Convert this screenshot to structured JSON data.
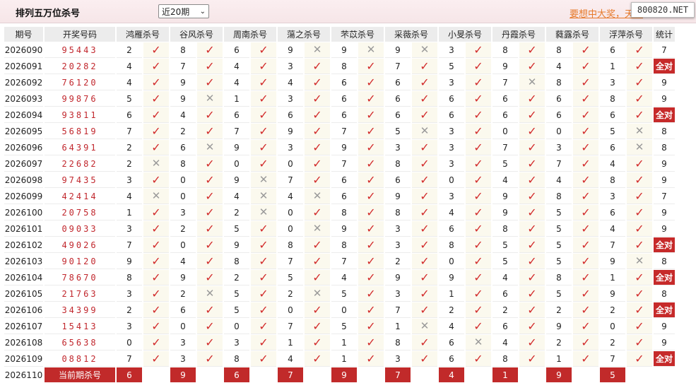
{
  "header": {
    "title": "排列五万位杀号",
    "period_selected": "近20期",
    "promo_text": "要想中大奖，天天",
    "watermark": "800820.NET"
  },
  "columns": {
    "issue": "期号",
    "code": "开奖号码",
    "experts": [
      "鸿雁杀号",
      "谷风杀号",
      "周南杀号",
      "蕩之杀号",
      "芣苡杀号",
      "采薇杀号",
      "小旻杀号",
      "丹霞杀号",
      "蕤露杀号",
      "浮萍杀号"
    ],
    "stat": "统计"
  },
  "rows": [
    {
      "issue": "2026090",
      "code": "95443",
      "kills": [
        2,
        8,
        6,
        9,
        9,
        9,
        3,
        8,
        8,
        6
      ],
      "hits": [
        1,
        1,
        1,
        0,
        0,
        0,
        1,
        1,
        1,
        1
      ],
      "stat": "7",
      "all": false
    },
    {
      "issue": "2026091",
      "code": "20282",
      "kills": [
        4,
        7,
        4,
        3,
        8,
        7,
        5,
        9,
        4,
        1
      ],
      "hits": [
        1,
        1,
        1,
        1,
        1,
        1,
        1,
        1,
        1,
        1
      ],
      "stat": "全对",
      "all": true
    },
    {
      "issue": "2026092",
      "code": "76120",
      "kills": [
        4,
        9,
        4,
        4,
        6,
        6,
        3,
        7,
        8,
        3
      ],
      "hits": [
        1,
        1,
        1,
        1,
        1,
        1,
        1,
        0,
        1,
        1
      ],
      "stat": "9",
      "all": false
    },
    {
      "issue": "2026093",
      "code": "99876",
      "kills": [
        5,
        9,
        1,
        3,
        6,
        6,
        6,
        6,
        6,
        8
      ],
      "hits": [
        1,
        0,
        1,
        1,
        1,
        1,
        1,
        1,
        1,
        1
      ],
      "stat": "9",
      "all": false
    },
    {
      "issue": "2026094",
      "code": "93811",
      "kills": [
        6,
        4,
        6,
        6,
        6,
        6,
        6,
        6,
        6,
        6
      ],
      "hits": [
        1,
        1,
        1,
        1,
        1,
        1,
        1,
        1,
        1,
        1
      ],
      "stat": "全对",
      "all": true
    },
    {
      "issue": "2026095",
      "code": "56819",
      "kills": [
        7,
        2,
        7,
        9,
        7,
        5,
        3,
        0,
        0,
        5
      ],
      "hits": [
        1,
        1,
        1,
        1,
        1,
        0,
        1,
        1,
        1,
        0
      ],
      "stat": "8",
      "all": false
    },
    {
      "issue": "2026096",
      "code": "64391",
      "kills": [
        2,
        6,
        9,
        3,
        9,
        3,
        3,
        7,
        3,
        6
      ],
      "hits": [
        1,
        0,
        1,
        1,
        1,
        1,
        1,
        1,
        1,
        0
      ],
      "stat": "8",
      "all": false
    },
    {
      "issue": "2026097",
      "code": "22682",
      "kills": [
        2,
        8,
        0,
        0,
        7,
        8,
        3,
        5,
        7,
        4
      ],
      "hits": [
        0,
        1,
        1,
        1,
        1,
        1,
        1,
        1,
        1,
        1
      ],
      "stat": "9",
      "all": false
    },
    {
      "issue": "2026098",
      "code": "97435",
      "kills": [
        3,
        0,
        9,
        7,
        6,
        6,
        0,
        4,
        4,
        8
      ],
      "hits": [
        1,
        1,
        0,
        1,
        1,
        1,
        1,
        1,
        1,
        1
      ],
      "stat": "9",
      "all": false
    },
    {
      "issue": "2026099",
      "code": "42414",
      "kills": [
        4,
        0,
        4,
        4,
        6,
        9,
        3,
        9,
        8,
        3
      ],
      "hits": [
        0,
        1,
        0,
        0,
        1,
        1,
        1,
        1,
        1,
        1
      ],
      "stat": "7",
      "all": false
    },
    {
      "issue": "2026100",
      "code": "20758",
      "kills": [
        1,
        3,
        2,
        0,
        8,
        8,
        4,
        9,
        5,
        6
      ],
      "hits": [
        1,
        1,
        0,
        1,
        1,
        1,
        1,
        1,
        1,
        1
      ],
      "stat": "9",
      "all": false
    },
    {
      "issue": "2026101",
      "code": "09033",
      "kills": [
        3,
        2,
        5,
        0,
        9,
        3,
        6,
        8,
        5,
        4
      ],
      "hits": [
        1,
        1,
        1,
        0,
        1,
        1,
        1,
        1,
        1,
        1
      ],
      "stat": "9",
      "all": false
    },
    {
      "issue": "2026102",
      "code": "49026",
      "kills": [
        7,
        0,
        9,
        8,
        8,
        3,
        8,
        5,
        5,
        7
      ],
      "hits": [
        1,
        1,
        1,
        1,
        1,
        1,
        1,
        1,
        1,
        1
      ],
      "stat": "全对",
      "all": true
    },
    {
      "issue": "2026103",
      "code": "90120",
      "kills": [
        9,
        4,
        8,
        7,
        7,
        2,
        0,
        5,
        5,
        9
      ],
      "hits": [
        1,
        1,
        1,
        1,
        1,
        1,
        1,
        1,
        1,
        0
      ],
      "stat": "8",
      "all": false
    },
    {
      "issue": "2026104",
      "code": "78670",
      "kills": [
        8,
        9,
        2,
        5,
        4,
        9,
        9,
        4,
        8,
        1
      ],
      "hits": [
        1,
        1,
        1,
        1,
        1,
        1,
        1,
        1,
        1,
        1
      ],
      "stat": "全对",
      "all": true
    },
    {
      "issue": "2026105",
      "code": "21763",
      "kills": [
        3,
        2,
        5,
        2,
        5,
        3,
        1,
        6,
        5,
        9
      ],
      "hits": [
        1,
        0,
        1,
        0,
        1,
        1,
        1,
        1,
        1,
        1
      ],
      "stat": "8",
      "all": false
    },
    {
      "issue": "2026106",
      "code": "34399",
      "kills": [
        2,
        6,
        5,
        0,
        0,
        7,
        2,
        2,
        2,
        2
      ],
      "hits": [
        1,
        1,
        1,
        1,
        1,
        1,
        1,
        1,
        1,
        1
      ],
      "stat": "全对",
      "all": true
    },
    {
      "issue": "2026107",
      "code": "15413",
      "kills": [
        3,
        0,
        0,
        7,
        5,
        1,
        4,
        6,
        9,
        0
      ],
      "hits": [
        1,
        1,
        1,
        1,
        1,
        0,
        1,
        1,
        1,
        1
      ],
      "stat": "9",
      "all": false
    },
    {
      "issue": "2026108",
      "code": "65638",
      "kills": [
        0,
        3,
        3,
        1,
        1,
        8,
        6,
        4,
        2,
        2
      ],
      "hits": [
        1,
        1,
        1,
        1,
        1,
        1,
        0,
        1,
        1,
        1
      ],
      "stat": "9",
      "all": false
    },
    {
      "issue": "2026109",
      "code": "08812",
      "kills": [
        7,
        3,
        8,
        4,
        1,
        3,
        6,
        8,
        1,
        7
      ],
      "hits": [
        1,
        1,
        1,
        1,
        1,
        1,
        1,
        1,
        1,
        1
      ],
      "stat": "全对",
      "all": true
    }
  ],
  "current": {
    "issue": "2026110",
    "label": "当前期杀号",
    "kills": [
      6,
      9,
      6,
      7,
      9,
      7,
      4,
      1,
      9,
      5
    ]
  }
}
